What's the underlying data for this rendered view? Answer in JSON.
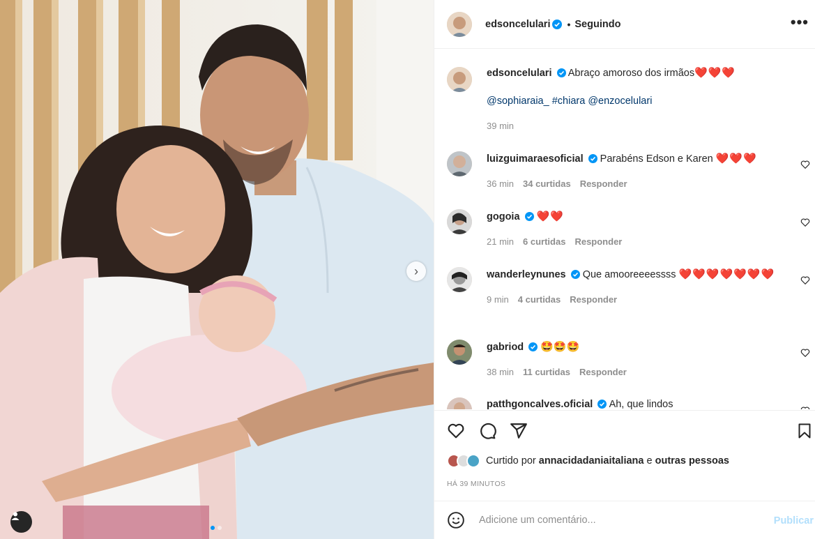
{
  "post": {
    "author": "edsoncelulari",
    "separator": "•",
    "follow_label": "Seguindo",
    "more_label": "•••"
  },
  "caption": {
    "username": "edsoncelulari",
    "text": "Abraço amoroso dos irmãos",
    "hearts": "❤️❤️❤️",
    "mentions": [
      "@sophiaraia_",
      "#chiara",
      "@enzocelulari"
    ],
    "time": "39 min"
  },
  "comments": [
    {
      "username": "luizguimaraesoficial",
      "text": "Parabéns Edson e Karen",
      "emoji": "❤️❤️❤️",
      "time": "36 min",
      "likes": "34 curtidas",
      "reply": "Responder"
    },
    {
      "username": "gogoia",
      "text": "",
      "emoji": "❤️❤️",
      "time": "21 min",
      "likes": "6 curtidas",
      "reply": "Responder"
    },
    {
      "username": "wanderleynunes",
      "text": "Que amooreeeessss",
      "emoji": "❤️❤️❤️❤️❤️❤️❤️",
      "time": "9 min",
      "likes": "4 curtidas",
      "reply": "Responder"
    },
    {
      "username": "gabriod",
      "text": "",
      "emoji": "🤩🤩🤩",
      "time": "38 min",
      "likes": "11 curtidas",
      "reply": "Responder"
    },
    {
      "username": "patthgoncalves.oficial",
      "text": "Ah, que lindos",
      "emoji": "",
      "time": "",
      "likes": "",
      "reply": ""
    }
  ],
  "likes": {
    "prefix": "Curtido por",
    "user": "annacidadaniaitaliana",
    "connector": "e",
    "suffix": "outras pessoas"
  },
  "timestamp": "HÁ 39 MINUTOS",
  "add_comment": {
    "placeholder": "Adicione um comentário...",
    "publish_label": "Publicar"
  },
  "colors": {
    "verified": "#0095f6",
    "link": "#00376b",
    "publish_disabled": "#b2dffc",
    "heart": "#e0245e"
  },
  "icons": [
    "verified-badge-icon",
    "more-options-icon",
    "heart-icon",
    "comment-icon",
    "share-icon",
    "bookmark-icon",
    "emoji-icon",
    "next-arrow-icon",
    "user-tag-icon"
  ]
}
